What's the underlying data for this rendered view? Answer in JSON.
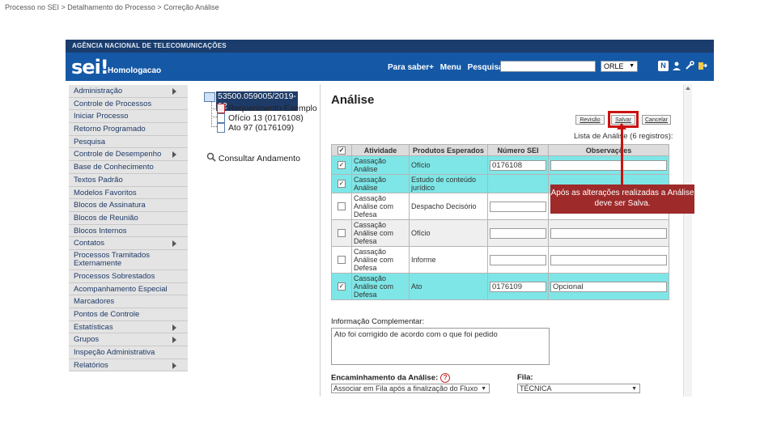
{
  "breadcrumb": "Processo no SEI > Detalhamento do Processo > Correção Análise",
  "agency": "AGÊNCIA NACIONAL DE TELECOMUNICAÇÕES",
  "header": {
    "logo": "sei!",
    "environment": "Homologacao",
    "links": [
      "Para saber+",
      "Menu",
      "Pesquisa"
    ],
    "search_value": "",
    "unit": "ORLE",
    "icons": [
      "n-icon",
      "user-icon",
      "tools-icon",
      "exit-icon"
    ],
    "icon_label_n": "N"
  },
  "menu": [
    {
      "label": "Administração",
      "arrow": true
    },
    {
      "label": "Controle de Processos",
      "arrow": false
    },
    {
      "label": "Iniciar Processo",
      "arrow": false
    },
    {
      "label": "Retorno Programado",
      "arrow": false
    },
    {
      "label": "Pesquisa",
      "arrow": false
    },
    {
      "label": "Controle de Desempenho",
      "arrow": true
    },
    {
      "label": "Base de Conhecimento",
      "arrow": false
    },
    {
      "label": "Textos Padrão",
      "arrow": false
    },
    {
      "label": "Modelos Favoritos",
      "arrow": false
    },
    {
      "label": "Blocos de Assinatura",
      "arrow": false
    },
    {
      "label": "Blocos de Reunião",
      "arrow": false
    },
    {
      "label": "Blocos Internos",
      "arrow": false
    },
    {
      "label": "Contatos",
      "arrow": true
    },
    {
      "label": "Processos Tramitados Externamente",
      "arrow": false,
      "two": true
    },
    {
      "label": "Processos Sobrestados",
      "arrow": false
    },
    {
      "label": "Acompanhamento Especial",
      "arrow": false
    },
    {
      "label": "Marcadores",
      "arrow": false
    },
    {
      "label": "Pontos de Controle",
      "arrow": false
    },
    {
      "label": "Estatísticas",
      "arrow": true
    },
    {
      "label": "Grupos",
      "arrow": true
    },
    {
      "label": "Inspeção Administrativa",
      "arrow": false
    },
    {
      "label": "Relatórios",
      "arrow": true
    }
  ],
  "tree": {
    "process": "53500.059005/2019-92",
    "docs": [
      "Requerimento Exemplo",
      "Ofício 13 (0176108)",
      "Ato 97 (0176109)"
    ],
    "consult": "Consultar Andamento"
  },
  "analysis": {
    "title": "Análise",
    "buttons": [
      "Revisão",
      "Salvar",
      "Cancelar"
    ],
    "caption": "Lista de Análise (6 registros):",
    "headers": [
      "Atividade",
      "Produtos Esperados",
      "Número SEI",
      "Observações"
    ],
    "header_check": "✓",
    "rows": [
      {
        "checked": true,
        "activity": "Cassação Análise",
        "product": "Ofício",
        "number": "0176108",
        "obs": "",
        "style": "sel",
        "has_inputs": true
      },
      {
        "checked": true,
        "activity": "Cassação Análise",
        "product": "Estudo de conteúdo jurídico",
        "number": "",
        "obs": "",
        "style": "sel",
        "has_inputs": false
      },
      {
        "checked": false,
        "activity": "Cassação Análise com Defesa",
        "product": "Despacho Decisório",
        "number": "",
        "obs": "",
        "style": "even",
        "has_inputs": true
      },
      {
        "checked": false,
        "activity": "Cassação Análise com Defesa",
        "product": "Ofício",
        "number": "",
        "obs": "",
        "style": "odd",
        "has_inputs": true
      },
      {
        "checked": false,
        "activity": "Cassação Análise com Defesa",
        "product": "Informe",
        "number": "",
        "obs": "",
        "style": "even",
        "has_inputs": true
      },
      {
        "checked": true,
        "activity": "Cassação Análise com Defesa",
        "product": "Ato",
        "number": "0176109",
        "obs": "Opcional",
        "style": "sel",
        "has_inputs": true
      }
    ],
    "complement_label": "Informação Complementar:",
    "complement_value": "Ato foi corrigido de acordo com o que foi pedido",
    "routing_label": "Encaminhamento da Análise:",
    "help_glyph": "?",
    "routing_value": "Associar em Fila após a finalização do Fluxo",
    "queue_label": "Fila:",
    "queue_value": "TÉCNICA"
  },
  "callout": "Após as alterações realizadas a Análise deve ser Salva.",
  "colors": {
    "header": "#1558a6",
    "topbar": "#1a3d6d",
    "selected_row": "#7ee6e6",
    "callout": "#9e2a2a",
    "highlight": "#cc1111"
  }
}
